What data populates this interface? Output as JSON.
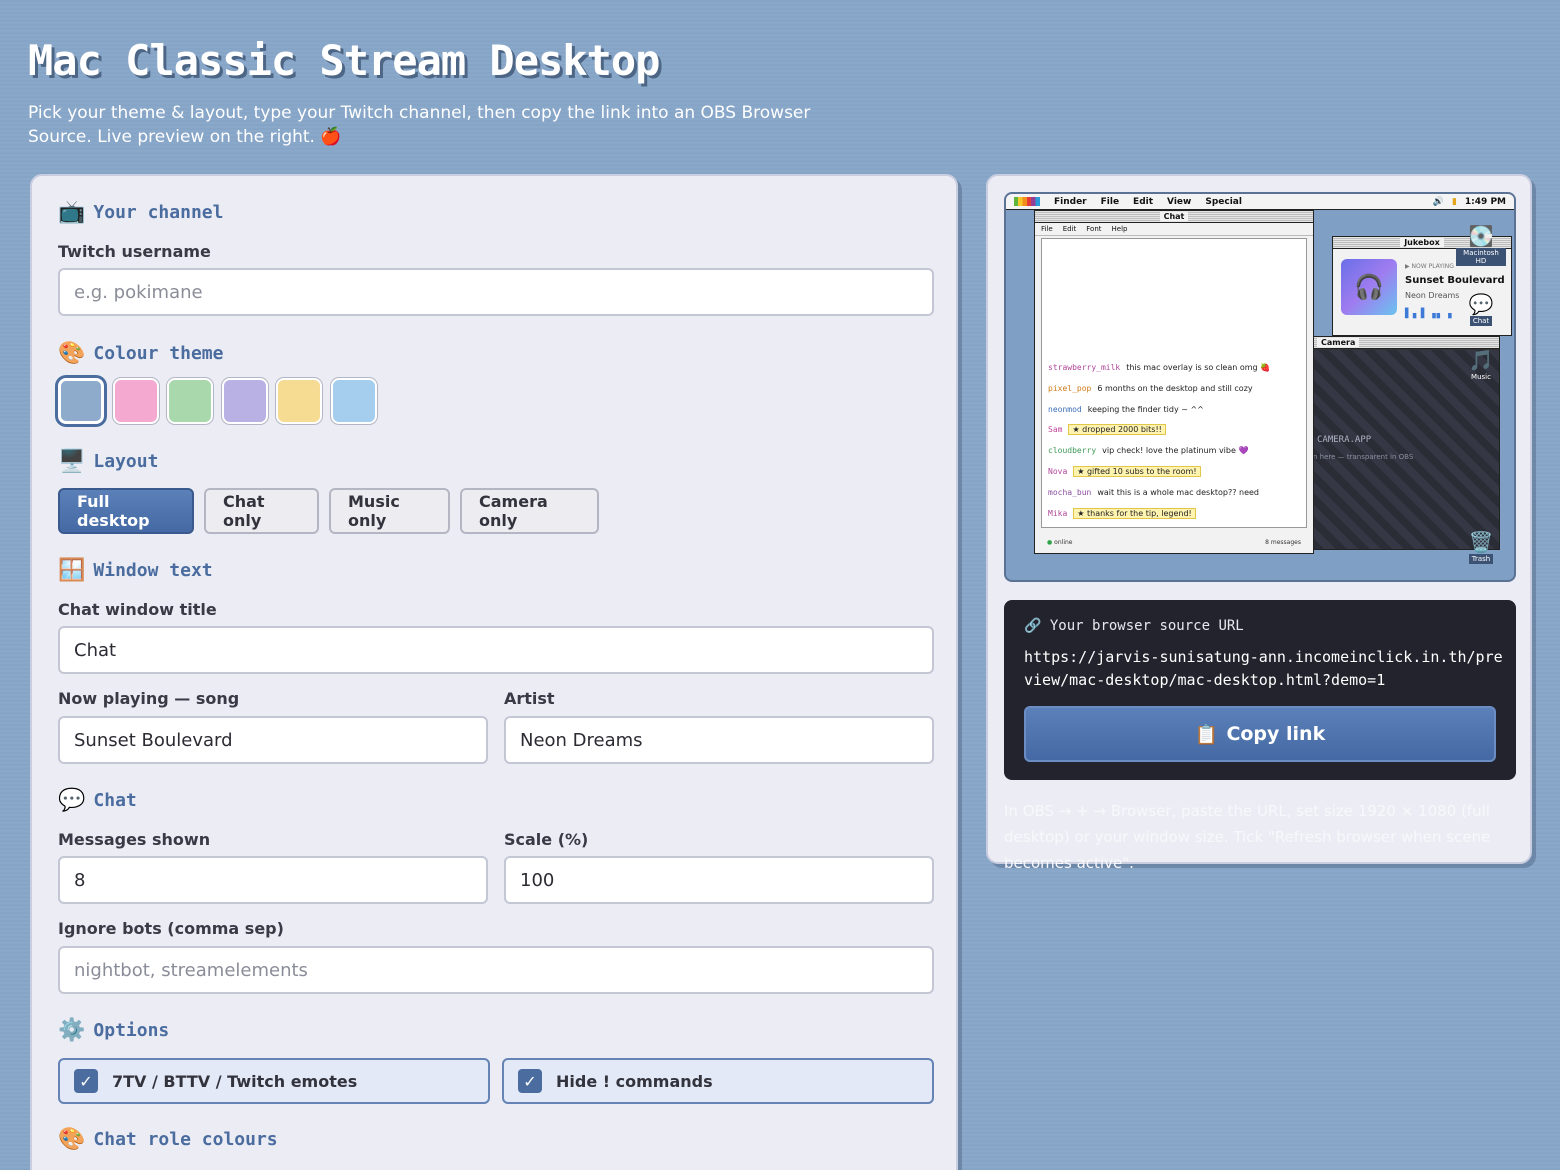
{
  "header": {
    "title": "Mac Classic Stream Desktop",
    "subtitle": "Pick your theme & layout, type your Twitch channel, then copy the link into an OBS Browser Source. Live preview on the right. 🍎"
  },
  "channel": {
    "heading": "Your channel",
    "heading_icon": "📺",
    "username_label": "Twitch username",
    "username_placeholder": "e.g. pokimane",
    "username_value": ""
  },
  "theme": {
    "heading": "Colour theme",
    "heading_icon": "🎨",
    "swatches": [
      {
        "name": "blue",
        "color": "#8fabcb",
        "active": true
      },
      {
        "name": "pink",
        "color": "#f3a9d0",
        "active": false
      },
      {
        "name": "green",
        "color": "#a8d8ab",
        "active": false
      },
      {
        "name": "purple",
        "color": "#b9b1e4",
        "active": false
      },
      {
        "name": "yellow",
        "color": "#f6dc93",
        "active": false
      },
      {
        "name": "sky",
        "color": "#a4cdee",
        "active": false
      }
    ]
  },
  "layout": {
    "heading": "Layout",
    "heading_icon": "🖥️",
    "options": [
      "Full desktop",
      "Chat only",
      "Music only",
      "Camera only"
    ],
    "selected": "Full desktop"
  },
  "window_text": {
    "heading": "Window text",
    "heading_icon": "🪟",
    "chat_title_label": "Chat window title",
    "chat_title_value": "Chat",
    "song_label": "Now playing — song",
    "song_value": "Sunset Boulevard",
    "artist_label": "Artist",
    "artist_value": "Neon Dreams"
  },
  "chat": {
    "heading": "Chat",
    "heading_icon": "💬",
    "messages_label": "Messages shown",
    "messages_value": "8",
    "scale_label": "Scale (%)",
    "scale_value": "100",
    "ignore_label": "Ignore bots (comma sep)",
    "ignore_placeholder": "nightbot, streamelements"
  },
  "options": {
    "heading": "Options",
    "heading_icon": "⚙️",
    "emotes_label": "7TV / BTTV / Twitch emotes",
    "emotes_checked": true,
    "hide_commands_label": "Hide ! commands",
    "hide_commands_checked": true
  },
  "role_colours": {
    "heading": "Chat role colours",
    "heading_icon": "🎨"
  },
  "preview": {
    "menubar": {
      "items": [
        "Finder",
        "File",
        "Edit",
        "View",
        "Special"
      ],
      "time": "1:49 PM"
    },
    "chat_window": {
      "title": "Chat",
      "menu": [
        "File",
        "Edit",
        "Font",
        "Help"
      ],
      "messages": [
        {
          "user": "strawberry_milk",
          "text": "this mac overlay is so clean omg 🍓",
          "color": "#b0479a",
          "highlight": false
        },
        {
          "user": "pixel_pop",
          "text": "6 months on the desktop and still cozy",
          "color": "#d07a16",
          "highlight": false
        },
        {
          "user": "neonmod",
          "text": "keeping the finder tidy ~ ^^",
          "color": "#3d6fb8",
          "highlight": false
        },
        {
          "user": "Sam",
          "text": "★ dropped 2000 bits!!",
          "color": "#c2479c",
          "highlight": true
        },
        {
          "user": "cloudberry",
          "text": "vip check! love the platinum vibe 💜",
          "color": "#3e9a56",
          "highlight": false
        },
        {
          "user": "Nova",
          "text": "★ gifted 10 subs to the room!",
          "color": "#b0479a",
          "highlight": true
        },
        {
          "user": "mocha_bun",
          "text": "wait this is a whole mac desktop?? need",
          "color": "#8a4f9f",
          "highlight": false
        },
        {
          "user": "Mika",
          "text": "★ thanks for the tip, legend!",
          "color": "#b0479a",
          "highlight": true
        }
      ],
      "status": "online",
      "count": "8 messages"
    },
    "jukebox": {
      "title": "Jukebox",
      "now_playing_label": "▶ NOW PLAYING",
      "song": "Sunset Boulevard",
      "artist": "Neon Dreams"
    },
    "camera": {
      "title": "Camera",
      "app_label": "CAMERA.APP",
      "hint": "n here — transparent in OBS"
    },
    "desktop_icons": [
      {
        "name": "Macintosh HD",
        "icon": "💽"
      },
      {
        "name": "Chat",
        "icon": "💬"
      },
      {
        "name": "Music",
        "icon": "🎵"
      },
      {
        "name": "Trash",
        "icon": "🗑️"
      }
    ]
  },
  "url_box": {
    "heading": "Your browser source URL",
    "heading_icon": "🔗",
    "url": "https://jarvis-sunisatung-ann.incomeinclick.in.th/preview/mac-desktop/mac-desktop.html?demo=1",
    "copy_label": "Copy link",
    "copy_icon": "📋"
  },
  "howto": {
    "text": "In OBS → + → Browser, paste the URL, set size 1920 × 1080 (full desktop) or your window size. Tick \"Refresh browser when scene becomes active\"."
  }
}
